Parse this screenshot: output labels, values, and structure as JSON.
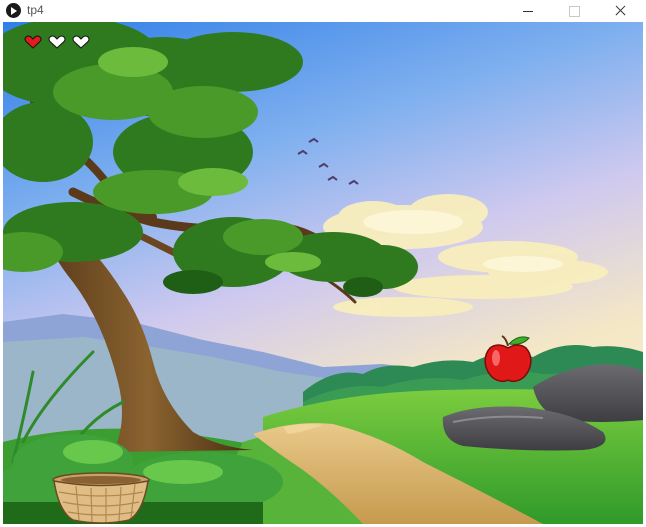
{
  "window": {
    "title": "tp4",
    "app_icon": "play-icon",
    "controls": [
      "minimize-icon",
      "maximize-icon",
      "close-icon"
    ]
  },
  "game": {
    "lives": {
      "total": 3,
      "remaining": 1
    },
    "colors": {
      "heart_full": "#e41b1b",
      "heart_empty": "#ffffff",
      "sky_top": "#3f8ff2",
      "sky_bottom": "#f3e9c2",
      "grass": "#4cb23a",
      "path": "#d9b56a",
      "apple": "#e11818"
    },
    "objects": [
      "apple-icon",
      "basket-icon",
      "tree",
      "birds"
    ]
  }
}
